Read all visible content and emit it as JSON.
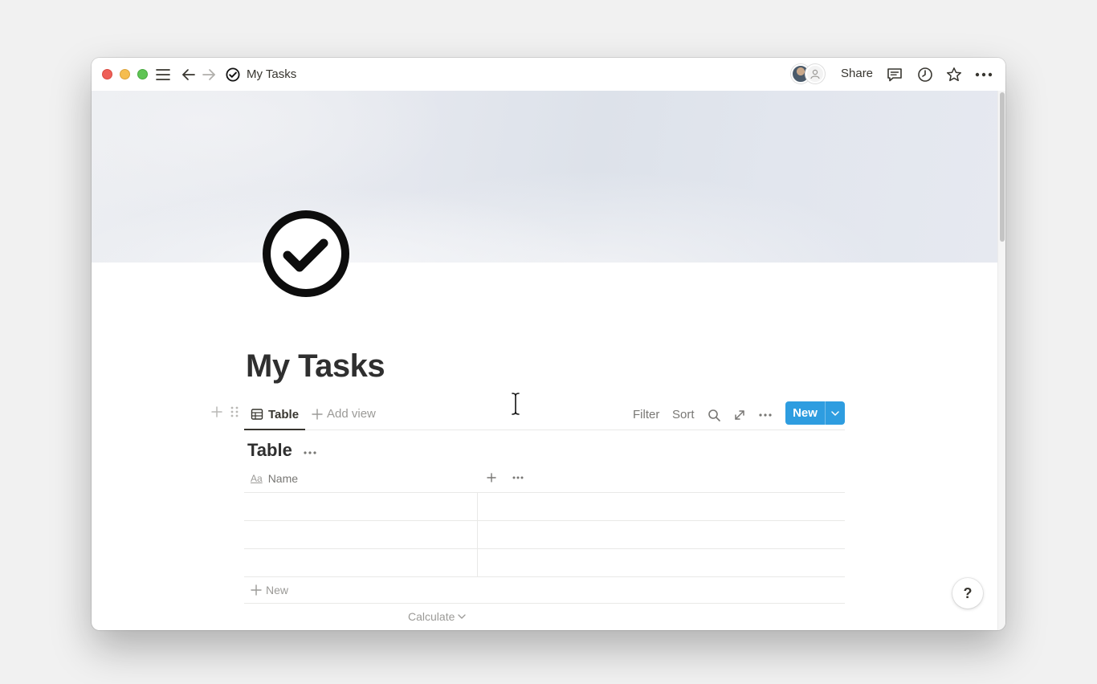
{
  "window": {
    "title": "My Tasks"
  },
  "topbar": {
    "share_label": "Share"
  },
  "page": {
    "title": "My Tasks"
  },
  "views": {
    "active_tab": "Table",
    "add_view_label": "Add view",
    "filter_label": "Filter",
    "sort_label": "Sort",
    "new_label": "New"
  },
  "table": {
    "title": "Table",
    "columns": [
      {
        "label": "Name",
        "type_icon": "Aa"
      }
    ],
    "rows": [
      {
        "name": ""
      },
      {
        "name": ""
      },
      {
        "name": ""
      }
    ],
    "new_row_label": "New",
    "calculate_label": "Calculate"
  },
  "help": {
    "label": "?"
  },
  "colors": {
    "accent": "#2e9de0",
    "text": "#37352f",
    "muted": "#9b9a97",
    "traffic_red": "#ee5f58",
    "traffic_yellow": "#f5bd4f",
    "traffic_green": "#5fc454"
  }
}
